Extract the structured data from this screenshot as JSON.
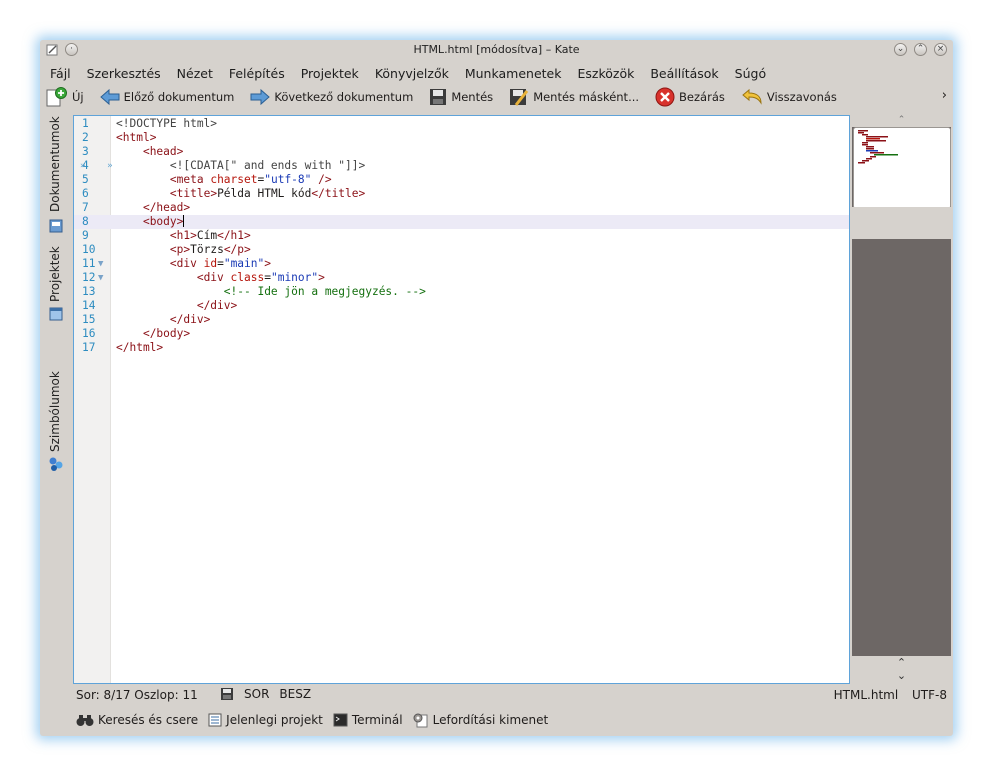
{
  "window": {
    "title": "HTML.html [módosítva] – Kate"
  },
  "menu": [
    "Fájl",
    "Szerkesztés",
    "Nézet",
    "Felépítés",
    "Projektek",
    "Könyvjelzők",
    "Munkamenetek",
    "Eszközök",
    "Beállítások",
    "Súgó"
  ],
  "toolbar": {
    "new": "Új",
    "prev_doc": "Előző dokumentum",
    "next_doc": "Következő dokumentum",
    "save": "Mentés",
    "save_as": "Mentés másként...",
    "close": "Bezárás",
    "undo": "Visszavonás",
    "more": "›"
  },
  "sidebar": {
    "documents": "Dokumentumok",
    "projects": "Projektek",
    "symbols": "Szimbólumok"
  },
  "editor": {
    "lines": [
      {
        "n": "1",
        "text": "<!DOCTYPE html>"
      },
      {
        "n": "2",
        "text": "<html>"
      },
      {
        "n": "3",
        "text": "    <head>"
      },
      {
        "n": "4",
        "text": "        <![CDATA[\" and ends with \"]]>"
      },
      {
        "n": "5",
        "text": "        <meta charset=\"utf-8\" />"
      },
      {
        "n": "6",
        "text": "        <title>Példa HTML kód</title>"
      },
      {
        "n": "7",
        "text": "    </head>"
      },
      {
        "n": "8",
        "text": "    <body>"
      },
      {
        "n": "9",
        "text": "        <h1>Cím</h1>"
      },
      {
        "n": "10",
        "text": "        <p>Törzs</p>"
      },
      {
        "n": "11",
        "text": "        <div id=\"main\">"
      },
      {
        "n": "12",
        "text": "            <div class=\"minor\">"
      },
      {
        "n": "13",
        "text": "                <!-- Ide jön a megjegyzés. -->"
      },
      {
        "n": "14",
        "text": "            </div>"
      },
      {
        "n": "15",
        "text": "        </div>"
      },
      {
        "n": "16",
        "text": "    </body>"
      },
      {
        "n": "17",
        "text": "</html>"
      }
    ],
    "current_line": 8,
    "fold_lines": [
      11,
      12
    ]
  },
  "status": {
    "position": "Sor: 8/17 Oszlop: 11",
    "mode1": "SOR",
    "mode2": "BESZ",
    "filename": "HTML.html",
    "encoding": "UTF-8"
  },
  "bottom_panel": {
    "search": "Keresés és csere",
    "project": "Jelenlegi projekt",
    "terminal": "Terminál",
    "build": "Lefordítási kimenet"
  }
}
